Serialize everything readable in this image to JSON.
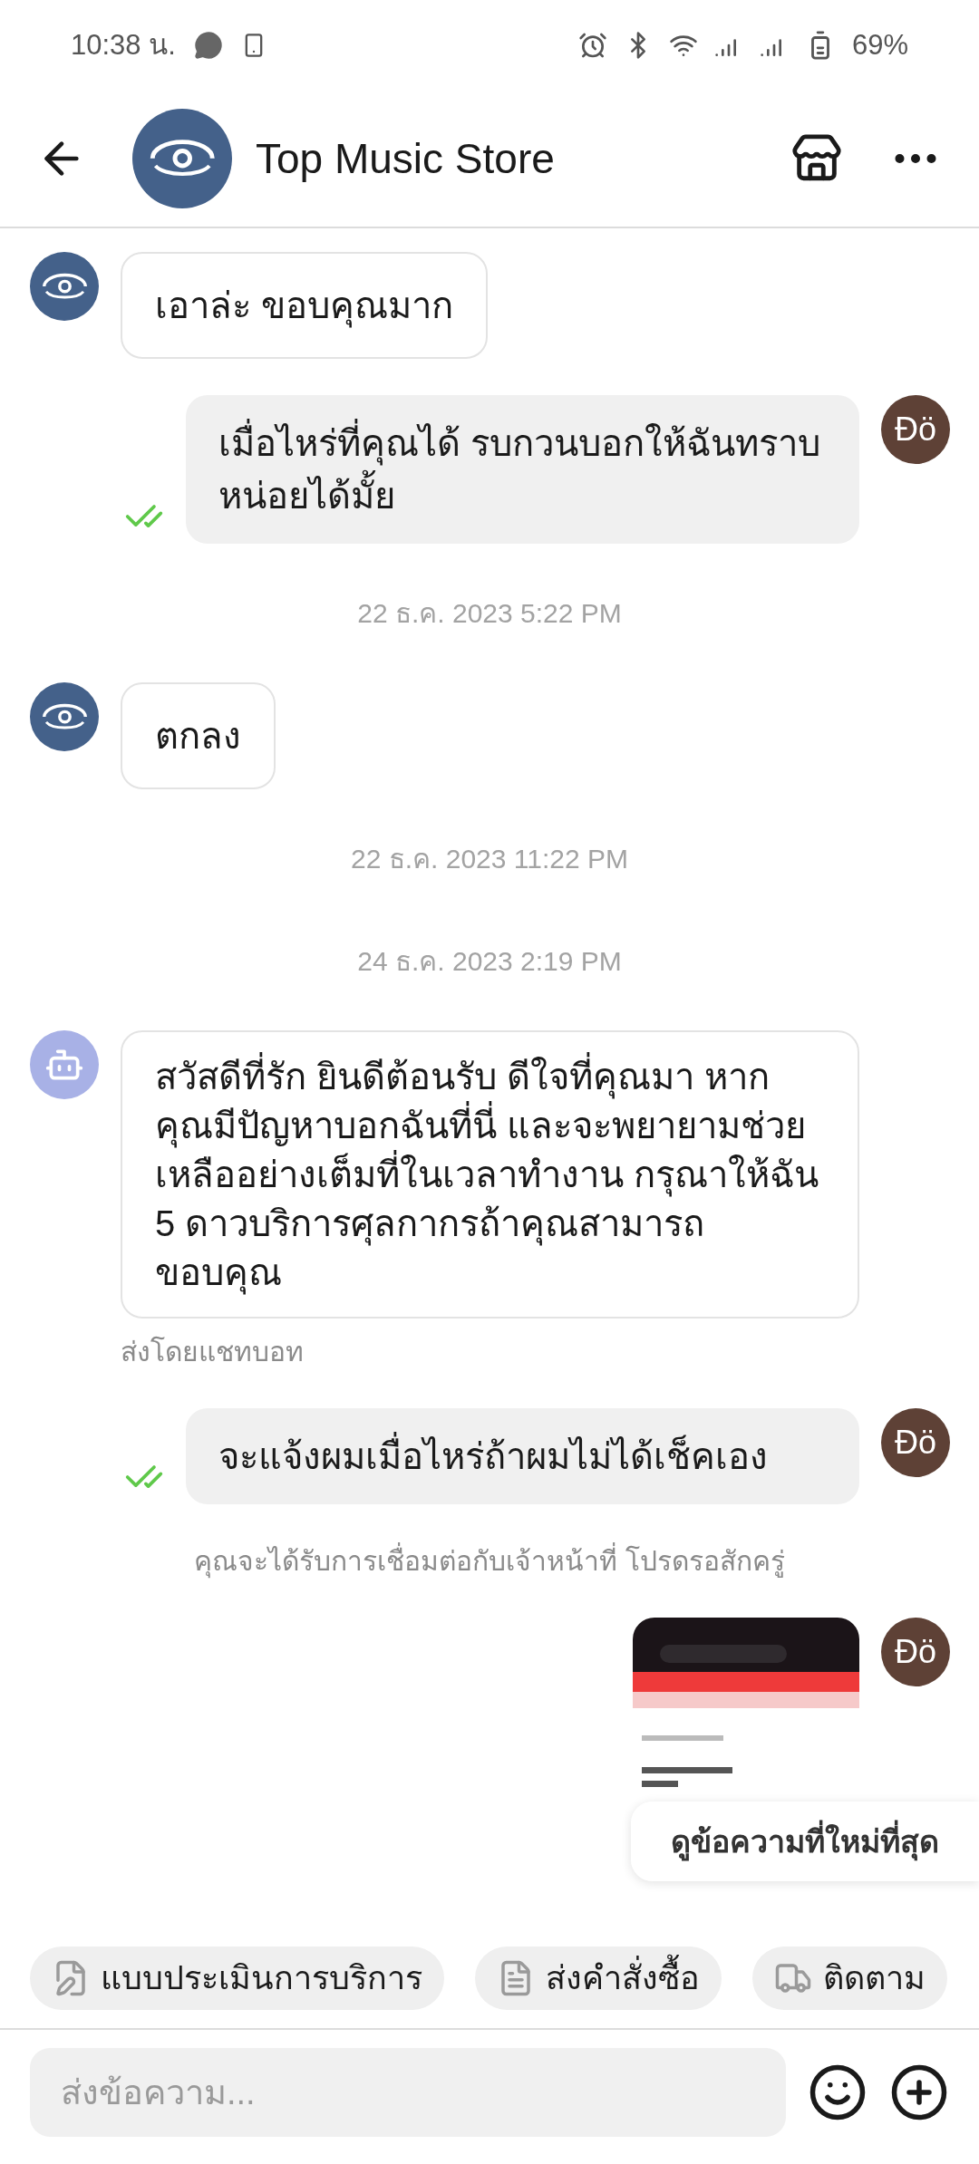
{
  "status_bar": {
    "time": "10:38 น.",
    "battery": "69%"
  },
  "header": {
    "title": "Top Music Store"
  },
  "messages": [
    {
      "kind": "incoming",
      "text": "เอาล่ะ ขอบคุณมาก"
    },
    {
      "kind": "outgoing",
      "text": "เมื่อไหร่ที่คุณได้ รบกวนบอกให้ฉันทราบหน่อยได้มั้ย",
      "avatar": "Đö",
      "read": true
    },
    {
      "kind": "timestamp",
      "text": "22 ธ.ค. 2023 5:22 PM"
    },
    {
      "kind": "incoming",
      "text": "ตกลง"
    },
    {
      "kind": "timestamp",
      "text": "22 ธ.ค. 2023 11:22 PM"
    },
    {
      "kind": "timestamp",
      "text": "24 ธ.ค. 2023 2:19 PM"
    },
    {
      "kind": "bot",
      "text": "สวัสดีที่รัก ยินดีต้อนรับ ดีใจที่คุณมา หากคุณมีปัญหาบอกฉันที่นี่ และจะพยายามช่วยเหลืออย่างเต็มที่ในเวลาทำงาน กรุณาให้ฉัน 5 ดาวบริการศุลกากรถ้าคุณสามารถ ขอบคุณ",
      "caption": "ส่งโดยแชทบอท"
    },
    {
      "kind": "outgoing",
      "text": "จะแจ้งผมเมื่อไหร่ถ้าผมไม่ได้เช็คเอง",
      "avatar": "Đö",
      "read": true
    },
    {
      "kind": "notice",
      "text": "คุณจะได้รับการเชื่อมต่อกับเจ้าหน้าที่ โปรดรอสักครู่"
    },
    {
      "avatar": "Đö"
    }
  ],
  "jump_button": "ดูข้อความที่ใหม่ที่สุด",
  "quick_replies": [
    {
      "kind": "survey",
      "label": "แบบประเมินการบริการ"
    },
    {
      "kind": "order",
      "label": "ส่งคำสั่งซื้อ"
    },
    {
      "kind": "tracking",
      "label": "ติดตาม"
    }
  ],
  "composer": {
    "placeholder": "ส่งข้อความ..."
  }
}
